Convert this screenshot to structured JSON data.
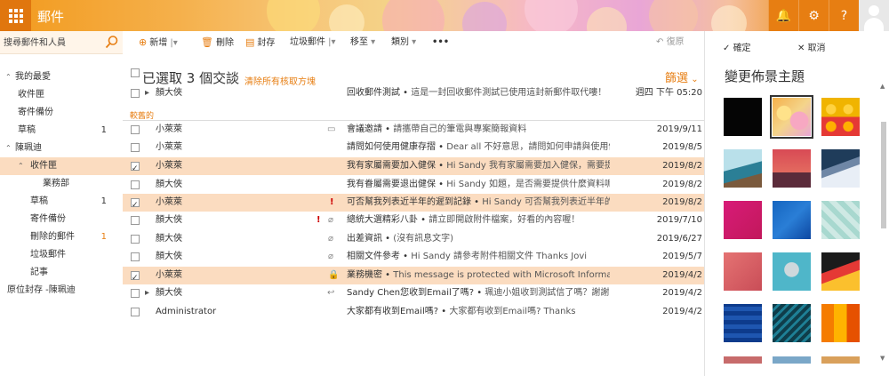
{
  "app": {
    "title": "郵件"
  },
  "header_icons": [
    "bell-icon",
    "gear-icon",
    "help-icon"
  ],
  "header_glyphs": {
    "bell": "🔔",
    "gear": "⚙",
    "help": "?"
  },
  "search": {
    "placeholder": "搜尋郵件和人員"
  },
  "nav": {
    "favorites": "我的最愛",
    "fav_inbox": "收件匣",
    "fav_sent": "寄件備份",
    "fav_drafts": "草稿",
    "fav_drafts_count": "1",
    "account": "陳珮迪",
    "inbox": "收件匣",
    "subfolder": "業務部",
    "drafts": "草稿",
    "drafts_count": "1",
    "sent": "寄件備份",
    "deleted": "刪除的郵件",
    "deleted_count": "1",
    "junk": "垃圾郵件",
    "notes": "記事",
    "archive": "原位封存 -陳珮迪"
  },
  "toolbar": {
    "new": "新增",
    "delete": "刪除",
    "archive": "封存",
    "junk": "垃圾郵件",
    "move": "移至",
    "categories": "類別",
    "more": "•••",
    "undo": "復原"
  },
  "list": {
    "selection_title": "已選取 3 個交談",
    "clear_selection": "清除所有核取方塊",
    "filter": "篩選",
    "older_label": "較舊的",
    "rows": [
      {
        "from": "顏大俠",
        "subject": "回收郵件測試",
        "preview": "這是一封回收郵件測試已使用這封新郵件取代嘍！",
        "date": "週四 下午 05:20"
      },
      {
        "from": "小萊萊",
        "subject": "會議邀請",
        "preview": "請攜帶自己的筆電與專案簡報資料",
        "date": "2019/9/11"
      },
      {
        "from": "小萊萊",
        "subject": "請問如何使用健康存摺",
        "preview": "Dear all 不好意思，請問如何申請與使用健康存摺",
        "date": "2019/8/5"
      },
      {
        "from": "小萊萊",
        "subject": "我有家屬需要加入健保",
        "preview": "Hi Sandy 我有家屬需要加入健保，需要提供哪些資料",
        "date": "2019/8/2"
      },
      {
        "from": "顏大俠",
        "subject": "我有眷屬需要退出健保",
        "preview": "Hi Sandy 如題，是否需要提供什麼資料呢？謝謝",
        "date": "2019/8/2"
      },
      {
        "from": "小萊萊",
        "subject": "可否幫我列表近半年的遲到記錄",
        "preview": "Hi Sandy 可否幫我列表近半年的遲到記錄",
        "date": "2019/8/2"
      },
      {
        "from": "顏大俠",
        "subject": "總統大選精彩八卦",
        "preview": "請立即開啟附件檔案，好看的內容喔！",
        "date": "2019/7/10"
      },
      {
        "from": "顏大俠",
        "subject": "出差資訊",
        "preview": "(沒有訊息文字)",
        "date": "2019/6/27"
      },
      {
        "from": "顏大俠",
        "subject": "相關文件參考",
        "preview": "Hi Sandy 請參考附件相關文件 Thanks Jovi",
        "date": "2019/5/7"
      },
      {
        "from": "小萊萊",
        "subject": "業務機密",
        "preview": "This message is protected with Microsoft Information Protection",
        "date": "2019/4/2"
      },
      {
        "from": "顏大俠",
        "subject": "Sandy Chen您收到Email了嗎?",
        "preview": "珮迪小姐收到測試信了嗎？謝謝",
        "date": "2019/4/2"
      },
      {
        "from": "Administrator",
        "subject": "大家都有收到Email嗎?",
        "preview": "大家都有收到Email嗎? Thanks",
        "date": "2019/4/2"
      }
    ]
  },
  "panel": {
    "ok": "確定",
    "cancel": "取消",
    "title": "變更佈景主題"
  },
  "colors": {
    "accent": "#e77e12",
    "selection": "#fbdcc0",
    "flag": "#cc0000"
  }
}
